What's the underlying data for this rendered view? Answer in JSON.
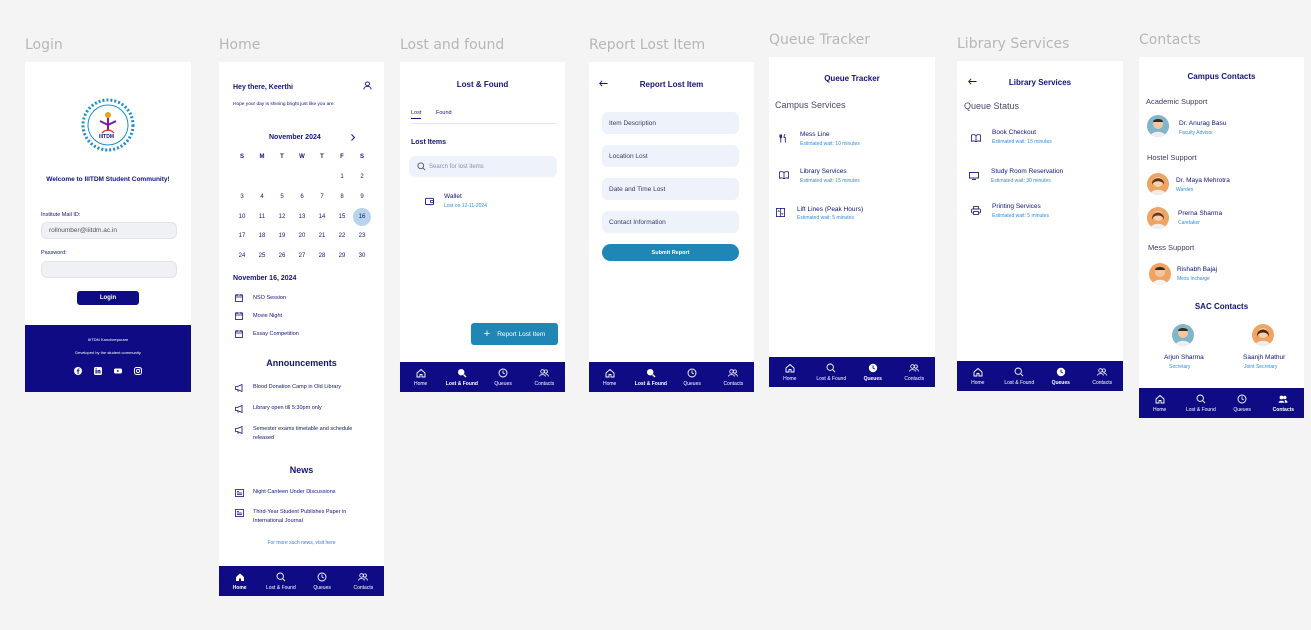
{
  "frames": {
    "login": {
      "label": "Login",
      "welcome": "Welcome to IIITDM Student Community!",
      "logo_text": "IIITDM",
      "mail_label": "Institute Mail ID:",
      "mail_placeholder": "rollnumber@iiitdm.ac.in",
      "password_label": "Password:",
      "login_button": "Login",
      "footer_line1": "IIITDM Kancheepuram",
      "footer_line2": "Developed by the student community",
      "social_icons": [
        "facebook-icon",
        "linkedin-icon",
        "youtube-icon",
        "instagram-icon"
      ]
    },
    "home": {
      "label": "Home",
      "greeting": "Hey there, Keerthi",
      "subgreeting": "Hope your day is shining bright just like you are.",
      "month": "November 2024",
      "weekdays": [
        "S",
        "M",
        "T",
        "W",
        "T",
        "F",
        "S"
      ],
      "weeks": [
        [
          "",
          "",
          "",
          "",
          "",
          "1",
          "2"
        ],
        [
          "3",
          "4",
          "5",
          "6",
          "7",
          "8",
          "9"
        ],
        [
          "10",
          "11",
          "12",
          "13",
          "14",
          "15",
          "16"
        ],
        [
          "17",
          "18",
          "19",
          "20",
          "21",
          "22",
          "23"
        ],
        [
          "24",
          "25",
          "26",
          "27",
          "28",
          "29",
          "30"
        ]
      ],
      "selected_day": "16",
      "selected_date": "November 16, 2024",
      "events": [
        "NSO Session",
        "Movie Night",
        "Essay Competition"
      ],
      "announcements_title": "Announcements",
      "announcements": [
        "Blood Donation Camp in Old Library",
        "Library open till 5:30pm only",
        "Semester exams timetable and schedule released"
      ],
      "news_title": "News",
      "news": [
        "Night Canteen Under Discussions",
        "Third-Year Student Publishes Paper in International Journal"
      ],
      "news_more": "For more such news, visit here"
    },
    "lost_found": {
      "label": "Lost and found",
      "title": "Lost & Found",
      "tabs": [
        "Lost",
        "Found"
      ],
      "section": "Lost Items",
      "search_placeholder": "Search for lost items",
      "items": [
        {
          "name": "Wallet",
          "date": "Lost on 12-11-2024"
        }
      ],
      "report_button": "Report Lost Item"
    },
    "report": {
      "label": "Report Lost Item",
      "title": "Report Lost Item",
      "fields": [
        "Item Description",
        "Location Lost",
        "Date and Time Lost",
        "Contact Information"
      ],
      "submit": "Submit Report"
    },
    "queue": {
      "label": "Queue Tracker",
      "title": "Queue Tracker",
      "section": "Campus Services",
      "items": [
        {
          "name": "Mess Line",
          "wait": "Estimated wait: 10 minutes"
        },
        {
          "name": "Library Services",
          "wait": "Estimated wait: 15 minutes"
        },
        {
          "name": "Lift Lines (Peak Hours)",
          "wait": "Estimated wait: 5 minutes"
        }
      ]
    },
    "library": {
      "label": "Library Services",
      "title": "Library Services",
      "section": "Queue Status",
      "items": [
        {
          "name": "Book Checkout",
          "wait": "Estimated wait: 15 minutes"
        },
        {
          "name": "Study Room Reservation",
          "wait": "Estimated wait: 30 minutes"
        },
        {
          "name": "Printing Services",
          "wait": "Estimated wait: 5 minutes"
        }
      ]
    },
    "contacts": {
      "label": "Contacts",
      "title": "Campus Contacts",
      "groups": [
        {
          "title": "Academic Support",
          "people": [
            {
              "name": "Dr. Anurag Basu",
              "role": "Faculty Advisor"
            }
          ]
        },
        {
          "title": "Hostel Support",
          "people": [
            {
              "name": "Dr. Maya Mehrotra",
              "role": "Warden"
            },
            {
              "name": "Prerna Sharma",
              "role": "Caretaker"
            }
          ]
        },
        {
          "title": "Mess Support",
          "people": [
            {
              "name": "Rishabh Bajaj",
              "role": "Mess Incharge"
            }
          ]
        }
      ],
      "sac_title": "SAC Contacts",
      "sac": [
        {
          "name": "Arjun Sharma",
          "role": "Secretary"
        },
        {
          "name": "Saanjh Mathur",
          "role": "Joint Secretary"
        }
      ]
    }
  },
  "nav": {
    "home": "Home",
    "lost_found": "Lost & Found",
    "queues": "Queues",
    "contacts": "Contacts"
  },
  "colors": {
    "primary": "#0f0b85",
    "accent_button": "#1f86b5",
    "link": "#2f8fe0",
    "field_bg": "#eef2fb"
  }
}
